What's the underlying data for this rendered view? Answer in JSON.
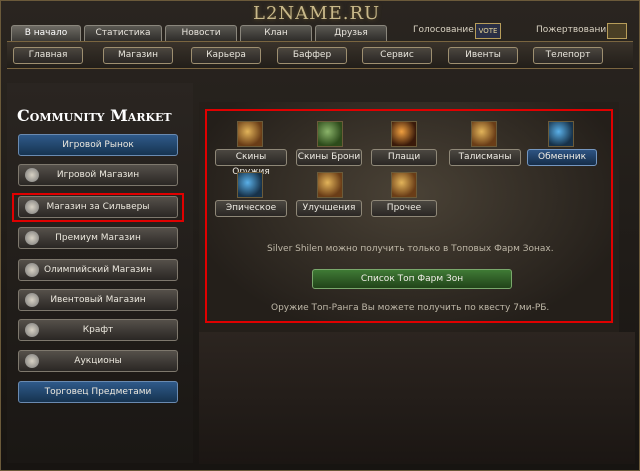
{
  "header": {
    "site_title": "L2NAME.RU",
    "vote_label": "Голосование",
    "donate_label": "Пожертвования",
    "vote_badge": "VOTE"
  },
  "top_tabs": [
    {
      "label": "В начало",
      "active": true
    },
    {
      "label": "Статистика",
      "active": false
    },
    {
      "label": "Новости",
      "active": false
    },
    {
      "label": "Клан",
      "active": false
    },
    {
      "label": "Друзья",
      "active": false
    }
  ],
  "nav": [
    "Главная",
    "Магазин",
    "Карьера",
    "Баффер",
    "Сервис",
    "Ивенты",
    "Телепорт"
  ],
  "sidebar": {
    "title": "Community Market",
    "items": [
      {
        "label": "Игровой Рынок",
        "style": "blue"
      },
      {
        "label": "Игровой Магазин",
        "style": "gray"
      },
      {
        "label": "Магазин за Сильверы",
        "style": "gray"
      },
      {
        "label": "Премиум Магазин",
        "style": "gray"
      },
      {
        "label": "Олимпийский Магазин",
        "style": "gray"
      },
      {
        "label": "Ивентовый Магазин",
        "style": "gray"
      },
      {
        "label": "Крафт",
        "style": "gray"
      },
      {
        "label": "Аукционы",
        "style": "gray"
      },
      {
        "label": "Торговец Предметами",
        "style": "blue"
      }
    ]
  },
  "categories": [
    {
      "label": "Скины Оружия",
      "icon": "weapon-skin-icon",
      "active": false
    },
    {
      "label": "Скины Брони",
      "icon": "armor-skin-icon",
      "active": false
    },
    {
      "label": "Плащи",
      "icon": "cloak-icon",
      "active": false
    },
    {
      "label": "Талисманы",
      "icon": "talisman-icon",
      "active": false
    },
    {
      "label": "Обменник",
      "icon": "exchange-icon",
      "active": true
    },
    {
      "label": "Эпическое",
      "icon": "epic-icon",
      "active": false
    },
    {
      "label": "Улучшения",
      "icon": "upgrade-icon",
      "active": false
    },
    {
      "label": "Прочее",
      "icon": "other-icon",
      "active": false
    }
  ],
  "main": {
    "info_top": "Silver Shilen можно получить только в Топовых Фарм Зонах.",
    "farm_button": "Список Топ Фарм Зон",
    "info_bottom": "Оружие Топ-Ранга Вы можете получить по квесту 7ми-РБ."
  },
  "colors": {
    "accent_blue": "#2f5a8a",
    "accent_green": "#3f7a35",
    "highlight_red": "#e00000"
  }
}
